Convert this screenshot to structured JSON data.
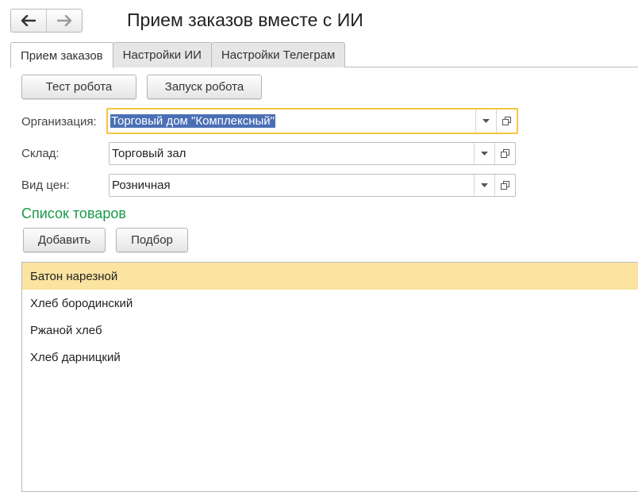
{
  "window": {
    "title": "Прием заказов вместе с ИИ"
  },
  "nav": {
    "back_icon": "arrow-left-icon",
    "forward_icon": "arrow-right-icon"
  },
  "tabs": [
    {
      "label": "Прием заказов",
      "active": true
    },
    {
      "label": "Настройки ИИ",
      "active": false
    },
    {
      "label": "Настройки Телеграм",
      "active": false
    }
  ],
  "toolbar": {
    "test_label": "Тест робота",
    "start_label": "Запуск робота"
  },
  "form": {
    "organization": {
      "label": "Организация:",
      "value": "Торговый дом \"Комплексный\""
    },
    "warehouse": {
      "label": "Склад:",
      "value": "Торговый зал"
    },
    "price_type": {
      "label": "Вид цен:",
      "value": "Розничная"
    }
  },
  "products": {
    "title": "Список товаров",
    "add_label": "Добавить",
    "pick_label": "Подбор",
    "items": [
      {
        "name": "Батон нарезной",
        "selected": true
      },
      {
        "name": "Хлеб бородинский",
        "selected": false
      },
      {
        "name": "Ржаной хлеб",
        "selected": false
      },
      {
        "name": "Хлеб дарницкий",
        "selected": false
      }
    ]
  },
  "colors": {
    "accent_green": "#1b9a4b",
    "focus_border": "#f5c542",
    "row_selected": "#fbe3a0",
    "text_selection": "#4a6fb5"
  }
}
